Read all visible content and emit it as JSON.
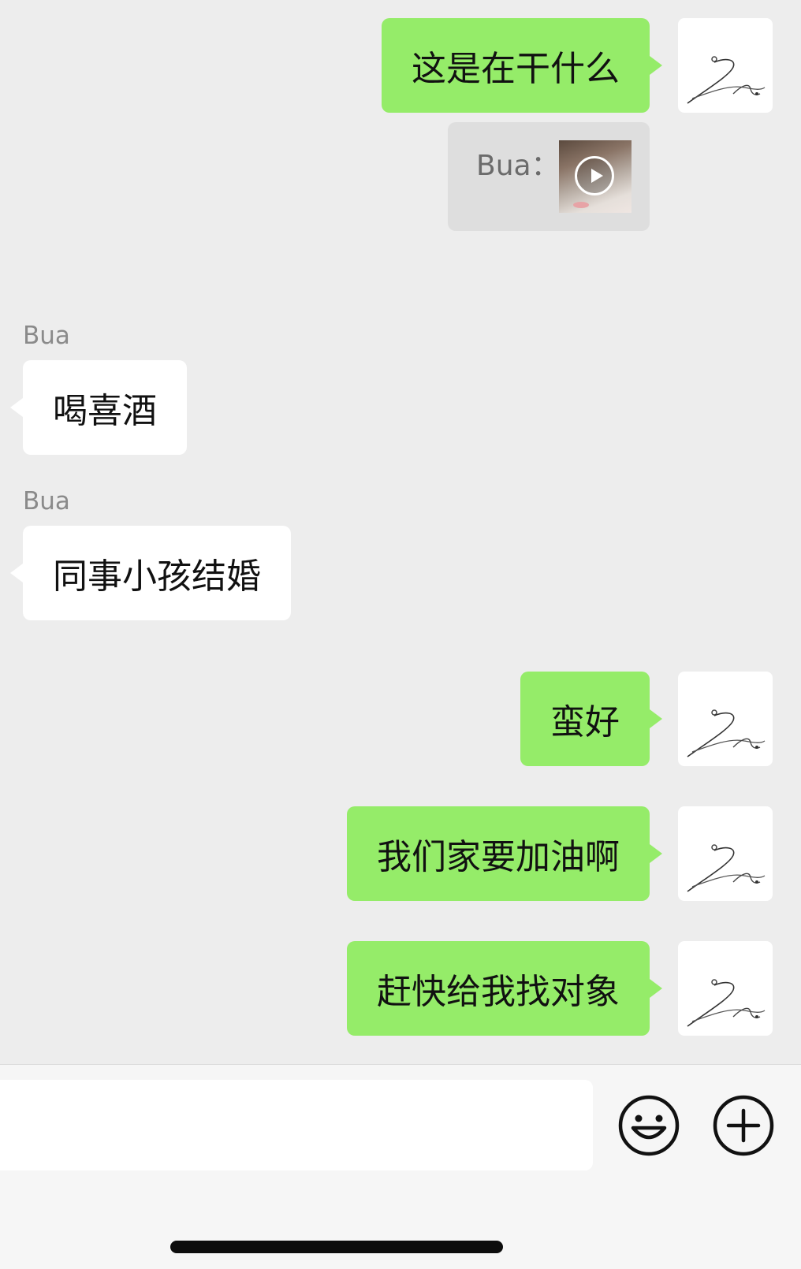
{
  "messages": [
    {
      "side": "out",
      "text": "这是在干什么"
    },
    {
      "side": "quote",
      "sender": "Bua",
      "separator": "：",
      "attachment": "video-thumbnail"
    },
    {
      "side": "in",
      "sender": "Bua",
      "text": "喝喜酒"
    },
    {
      "side": "in",
      "sender": "Bua",
      "text": "同事小孩结婚"
    },
    {
      "side": "out",
      "text": "蛮好"
    },
    {
      "side": "out",
      "text": "我们家要加油啊"
    },
    {
      "side": "out",
      "text": "赶快给我找对象"
    }
  ],
  "input_bar": {
    "text_value": "",
    "emoji_icon": "smiley-face-icon",
    "more_icon": "plus-circle-icon"
  },
  "colors": {
    "background": "#ededed",
    "outgoing_bubble": "#95ec69",
    "incoming_bubble": "#ffffff",
    "quote_bubble": "#dedede"
  }
}
